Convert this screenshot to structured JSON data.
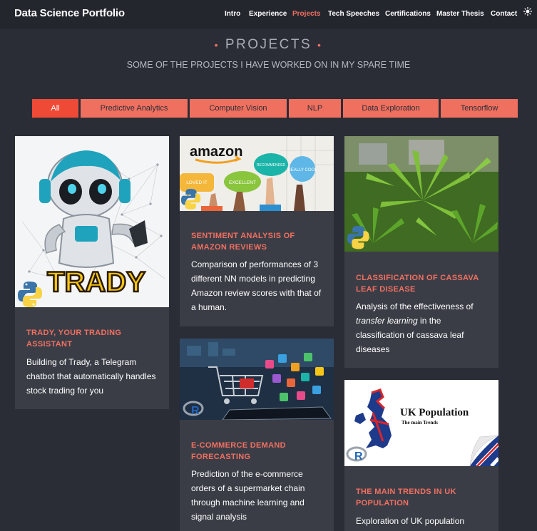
{
  "brand": "Data Science Portfolio",
  "nav": [
    {
      "label": "Intro",
      "active": false
    },
    {
      "label": "Experience",
      "active": false
    },
    {
      "label": "Projects",
      "active": true
    },
    {
      "label": "Tech Speeches",
      "active": false
    },
    {
      "label": "Certifications",
      "active": false
    },
    {
      "label": "Master Thesis",
      "active": false
    },
    {
      "label": "Contact",
      "active": false
    }
  ],
  "theme_icon": "sun-icon",
  "section": {
    "title": "PROJECTS",
    "bullet": "•",
    "subtitle": "SOME OF THE PROJECTS I HAVE WORKED ON IN MY SPARE TIME"
  },
  "filters": [
    {
      "label": "All",
      "active": true
    },
    {
      "label": "Predictive Analytics",
      "active": false
    },
    {
      "label": "Computer Vision",
      "active": false
    },
    {
      "label": "NLP",
      "active": false
    },
    {
      "label": "Data Exploration",
      "active": false
    },
    {
      "label": "Tensorflow",
      "active": false
    }
  ],
  "colors": {
    "accent": "#f07060",
    "accent_active": "#ef4a36",
    "background": "#2b2d36",
    "card": "#3b3d46",
    "navbar": "#24262e"
  },
  "cards": [
    {
      "title": "TRADY, YOUR TRADING ASSISTANT",
      "desc_parts": [
        "Building of Trady, a Telegram chatbot that automatically handles stock trading for you"
      ],
      "image": {
        "logo_text": "TRADY",
        "tech_icon": "python-icon"
      }
    },
    {
      "title": "SENTIMENT ANALYSIS OF AMAZON REVIEWS",
      "desc_parts": [
        "Comparison of performances of 3 different NN models in predicting Amazon review scores with that of a human."
      ],
      "image": {
        "logo_text": "amazon",
        "bubbles": [
          "LOVED IT",
          "EXCELLENT",
          "RECOMMENDED",
          "REALLY COOL"
        ],
        "tech_icon": "python-icon"
      }
    },
    {
      "title": "CLASSIFICATION OF CASSAVA LEAF DISEASE",
      "desc_parts": [
        "Analysis of the effectiveness of ",
        "transfer learning",
        " in the classification of cassava leaf diseases"
      ],
      "image": {
        "tech_icon": "python-icon"
      }
    },
    {
      "title": "E-COMMERCE DEMAND FORECASTING",
      "desc_parts": [
        "Prediction of the e-commerce orders of a supermarket chain through machine learning and signal analysis"
      ],
      "image": {
        "tech_icon": "r-icon"
      }
    },
    {
      "title": "THE MAIN TRENDS IN UK POPULATION",
      "desc_parts": [
        "Exploration of UK population"
      ],
      "image": {
        "heading": "UK Population",
        "subheading": "The main Trends",
        "tech_icon": "r-icon"
      }
    }
  ]
}
